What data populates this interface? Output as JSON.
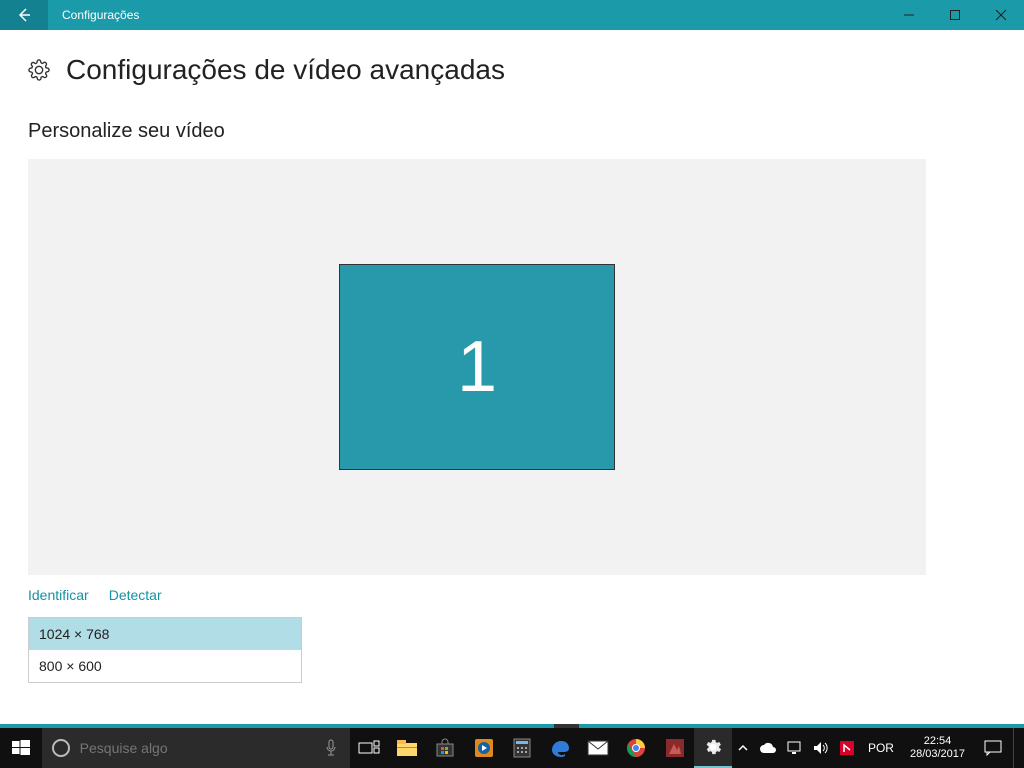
{
  "window": {
    "title": "Configurações"
  },
  "page": {
    "heading": "Configurações de vídeo avançadas",
    "section": "Personalize seu vídeo",
    "monitor_number": "1",
    "identify_link": "Identificar",
    "detect_link": "Detectar"
  },
  "resolutions": {
    "options": [
      {
        "label": "1024 × 768",
        "selected": true
      },
      {
        "label": "800 × 600",
        "selected": false
      }
    ]
  },
  "taskbar": {
    "search_placeholder": "Pesquise algo",
    "language": "POR",
    "time": "22:54",
    "date": "28/03/2017"
  }
}
